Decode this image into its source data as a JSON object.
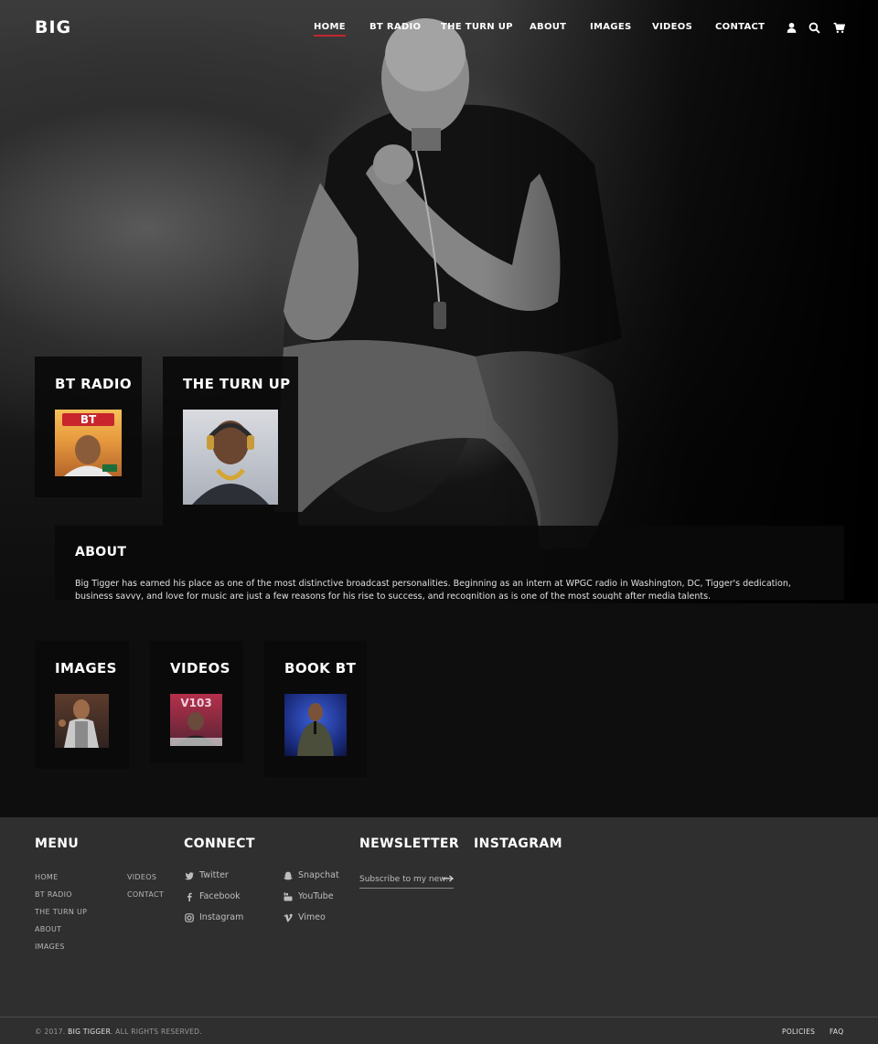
{
  "nav": {
    "logo": "BIG",
    "items": [
      {
        "label": "HOME",
        "active": true
      },
      {
        "label": "BT RADIO"
      },
      {
        "label": "THE TURN UP"
      },
      {
        "label": "ABOUT"
      },
      {
        "label": "IMAGES"
      },
      {
        "label": "VIDEOS"
      },
      {
        "label": "CONTACT"
      }
    ],
    "icons": [
      "user-icon",
      "search-icon",
      "cart-icon"
    ],
    "active_color": "#c0272d"
  },
  "cards": {
    "bt_radio": {
      "title": "BT RADIO",
      "thumb_text": "BT"
    },
    "turn_up": {
      "title": "THE TURN UP"
    },
    "images": {
      "title": "IMAGES"
    },
    "videos": {
      "title": "VIDEOS",
      "thumb_text": "V103"
    },
    "book_bt": {
      "title": "BOOK BT"
    }
  },
  "about": {
    "title": "ABOUT",
    "text": "Big Tigger has earned his place as one of the most distinctive broadcast personalities. Beginning as an intern at WPGC radio in Washington, DC, Tigger's dedication, business savvy, and love for music are just a few reasons for his rise to success, and recognition as is one of the most sought after media talents."
  },
  "footer": {
    "menu": {
      "title": "MENU",
      "col1": [
        "HOME",
        "BT RADIO",
        "THE TURN UP",
        "ABOUT",
        "IMAGES"
      ],
      "col2": [
        "VIDEOS",
        "CONTACT"
      ]
    },
    "connect": {
      "title": "CONNECT",
      "col1": [
        {
          "label": "Twitter",
          "icon": "twitter-icon"
        },
        {
          "label": "Facebook",
          "icon": "facebook-icon"
        },
        {
          "label": "Instagram",
          "icon": "instagram-icon"
        }
      ],
      "col2": [
        {
          "label": "Snapchat",
          "icon": "snapchat-icon"
        },
        {
          "label": "YouTube",
          "icon": "youtube-icon"
        },
        {
          "label": "Vimeo",
          "icon": "vimeo-icon"
        }
      ]
    },
    "newsletter": {
      "title": "NEWSLETTER",
      "placeholder": "Subscribe to my news"
    },
    "instagram": {
      "title": "INSTAGRAM"
    }
  },
  "bottom": {
    "copyright_prefix": "© 2017.",
    "brand": "BIG TIGGER",
    "copyright_suffix": ". ALL RIGHTS RESERVED.",
    "links": [
      "POLICIES",
      "FAQ"
    ]
  }
}
